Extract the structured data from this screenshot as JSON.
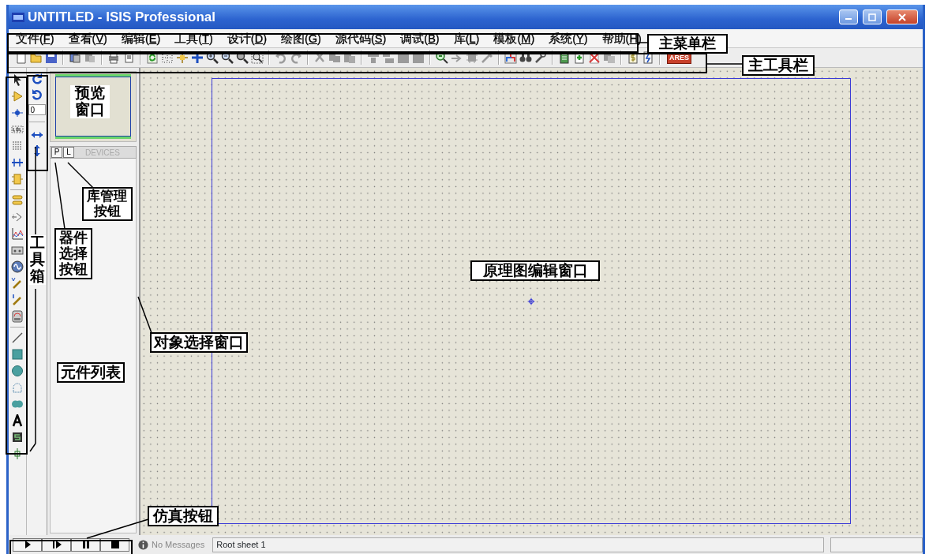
{
  "window": {
    "title": "UNTITLED - ISIS Professional"
  },
  "menu": [
    {
      "before": "文件(",
      "key": "F",
      "after": ")"
    },
    {
      "before": "查看(",
      "key": "V",
      "after": ")"
    },
    {
      "before": "编辑(",
      "key": "E",
      "after": ")"
    },
    {
      "before": "工具(",
      "key": "T",
      "after": ")"
    },
    {
      "before": "设计(",
      "key": "D",
      "after": ")"
    },
    {
      "before": "绘图(",
      "key": "G",
      "after": ")"
    },
    {
      "before": "源代码(",
      "key": "S",
      "after": ")"
    },
    {
      "before": "调试(",
      "key": "B",
      "after": ")"
    },
    {
      "before": "库(",
      "key": "L",
      "after": ")"
    },
    {
      "before": "模板(",
      "key": "M",
      "after": ")"
    },
    {
      "before": "系统(",
      "key": "Y",
      "after": ")"
    },
    {
      "before": "帮助(",
      "key": "H",
      "after": ")"
    }
  ],
  "toolbar": {
    "ares_label": "ARES"
  },
  "rotation": {
    "angle": "0"
  },
  "object_selector": {
    "tabs": [
      {
        "label": "P",
        "selected": false
      },
      {
        "label": "L",
        "selected": false
      }
    ],
    "title": "DEVICES"
  },
  "status_bar": {
    "messages": "No Messages",
    "sheet": "Root sheet 1"
  },
  "annotations": [
    {
      "text": "主菜单栏",
      "kind": "boxed"
    },
    {
      "text": "主工具栏",
      "kind": "boxed"
    },
    {
      "text": "预览窗口",
      "kind": "plain"
    },
    {
      "text": "库管理按钮",
      "kind": "boxed"
    },
    {
      "text": "工具箱",
      "kind": "plain"
    },
    {
      "text": "器件选择按钮",
      "kind": "boxed"
    },
    {
      "text": "原理图编辑窗口",
      "kind": "boxed"
    },
    {
      "text": "对象选择窗口",
      "kind": "boxed"
    },
    {
      "text": "元件列表",
      "kind": "boxed"
    },
    {
      "text": "仿真按钮",
      "kind": "boxed"
    }
  ]
}
